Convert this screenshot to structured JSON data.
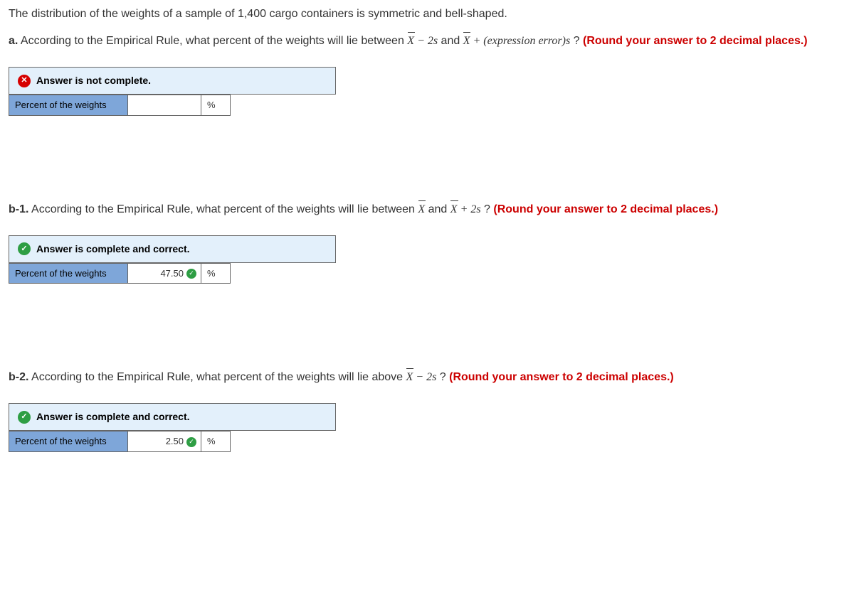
{
  "intro": "The distribution of the weights of a sample of 1,400 cargo containers is symmetric and bell-shaped.",
  "parts": {
    "a": {
      "label": "a.",
      "prompt_pre": " According to the Empirical Rule, what percent of the weights will lie between ",
      "math1_a": "X",
      "math1_op": " − ",
      "math1_b": "2s",
      "mid": " and ",
      "math2_a": "X",
      "math2_op": " + (expression error)",
      "math2_b": "s",
      "post": "  ? ",
      "round": "(Round your answer to 2 decimal places.)",
      "status_text": "Answer is not complete.",
      "row_label": "Percent of the weights",
      "value": "",
      "unit": "%"
    },
    "b1": {
      "label": "b-1.",
      "prompt_pre": " According to the Empirical Rule, what percent of the weights will lie between ",
      "math1_a": "X",
      "mid": " and ",
      "math2_a": "X",
      "math2_op": " + ",
      "math2_b": "2s",
      "post": " ? ",
      "round": "(Round your answer to 2 decimal places.)",
      "status_text": "Answer is complete and correct.",
      "row_label": "Percent of the weights",
      "value": "47.50",
      "unit": "%"
    },
    "b2": {
      "label": "b-2.",
      "prompt_pre": " According to the Empirical Rule, what percent of the weights will lie above ",
      "math1_a": "X",
      "math1_op": " − ",
      "math1_b": "2s",
      "post": " ? ",
      "round": "(Round your answer to 2 decimal places.)",
      "status_text": "Answer is complete and correct.",
      "row_label": "Percent of the weights",
      "value": "2.50",
      "unit": "%"
    }
  }
}
